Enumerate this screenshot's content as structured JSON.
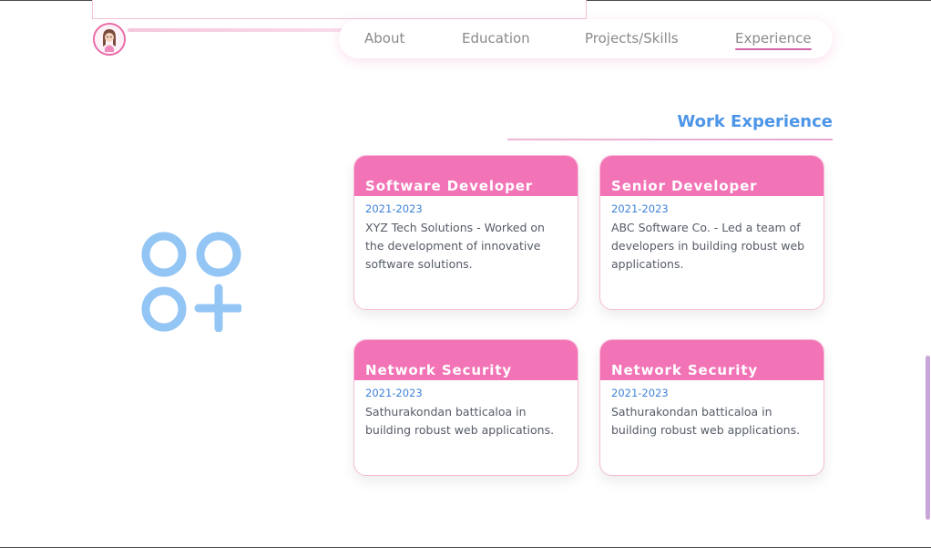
{
  "nav": {
    "items": [
      {
        "label": "About"
      },
      {
        "label": "Education"
      },
      {
        "label": "Projects/Skills"
      },
      {
        "label": "Experience"
      }
    ]
  },
  "experience": {
    "title": "Work Experience",
    "cards": [
      {
        "title": "Software Developer",
        "date": "2021-2023",
        "desc": "XYZ Tech Solutions - Worked on the development of innovative software solutions."
      },
      {
        "title": "Senior Developer",
        "date": "2021-2023",
        "desc": "ABC Software Co. - Led a team of developers in building robust web applications."
      },
      {
        "title": "Network Security",
        "date": "2021-2023",
        "desc": "Sathurakondan batticaloa in building robust web applications."
      },
      {
        "title": "Network Security",
        "date": "2021-2023",
        "desc": "Sathurakondan batticaloa in building robust web applications."
      }
    ]
  },
  "colors": {
    "accent_pink": "#f273b6",
    "accent_blue": "#4d95e8",
    "icon_blue": "#93c5f5"
  },
  "icons": {
    "logo": "apps-add-icon",
    "avatar": "avatar"
  }
}
